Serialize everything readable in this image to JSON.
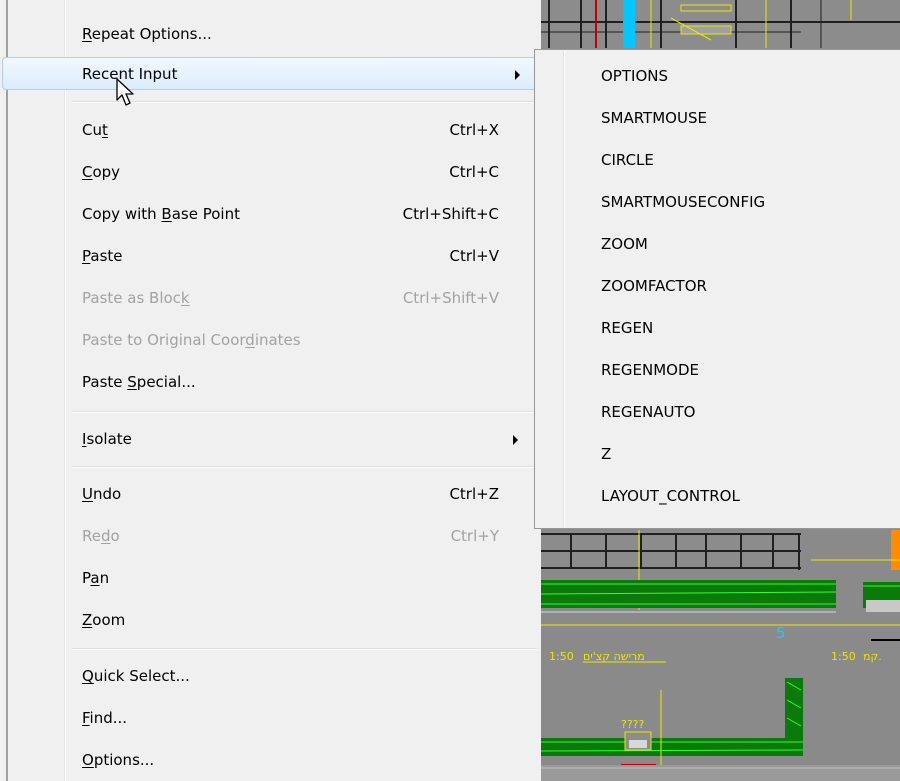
{
  "menu": {
    "repeat_options": "Repeat Options...",
    "recent_input": "Recent Input",
    "cut": {
      "label": "Cut",
      "shortcut": "Ctrl+X"
    },
    "copy": {
      "label": "Copy",
      "shortcut": "Ctrl+C"
    },
    "copy_base_point": {
      "label": "Copy with Base Point",
      "shortcut": "Ctrl+Shift+C"
    },
    "paste": {
      "label": "Paste",
      "shortcut": "Ctrl+V"
    },
    "paste_as_block": {
      "label": "Paste as Block",
      "shortcut": "Ctrl+Shift+V"
    },
    "paste_original_coords": "Paste to Original Coordinates",
    "paste_special": "Paste Special...",
    "isolate": "Isolate",
    "undo": {
      "label": "Undo",
      "shortcut": "Ctrl+Z"
    },
    "redo": {
      "label": "Redo",
      "shortcut": "Ctrl+Y"
    },
    "pan": "Pan",
    "zoom": "Zoom",
    "quick_select": "Quick Select...",
    "find": "Find...",
    "options": "Options..."
  },
  "submenu": {
    "items": [
      "OPTIONS",
      "SMARTMOUSE",
      "CIRCLE",
      "SMARTMOUSECONFIG",
      "ZOOM",
      "ZOOMFACTOR",
      "REGEN",
      "REGENMODE",
      "REGENAUTO",
      "Z",
      "LAYOUT_CONTROL"
    ]
  },
  "drawing": {
    "scale_label_1": "1:50",
    "hebrew_label_1": "מרישה קצ'ים",
    "scale_label_2": "1:50",
    "hebrew_label_2": "קמ.",
    "number_label": "5",
    "question_marks": "????"
  },
  "colors": {
    "menu_bg": "#f0f0f0",
    "hover_border": "#aecff7",
    "disabled_text": "#a2a2a2",
    "cad_bg": "#8a8a8a"
  }
}
